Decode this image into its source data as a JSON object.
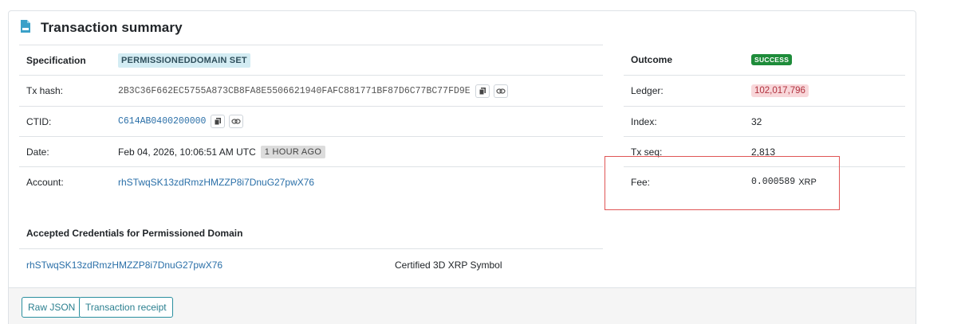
{
  "header": {
    "title": "Transaction summary",
    "icon": "document-icon"
  },
  "left": {
    "specification_label": "Specification",
    "tx_type": "PERMISSIONEDDOMAIN SET",
    "tx_hash_label": "Tx hash:",
    "tx_hash": "2B3C36F662EC5755A873CB8FA8E5506621940FAFC881771BF87D6C77BC77FD9E",
    "ctid_label": "CTID:",
    "ctid": "C614AB0400200000",
    "date_label": "Date:",
    "date": "Feb 04, 2026, 10:06:51 AM UTC",
    "date_ago": "1 HOUR AGO",
    "account_label": "Account:",
    "account": "rhSTwqSK13zdRmzHMZZP8i7DnuG27pwX76"
  },
  "right": {
    "outcome_label": "Outcome",
    "outcome": "SUCCESS",
    "ledger_label": "Ledger:",
    "ledger": "102,017,796",
    "index_label": "Index:",
    "index": "32",
    "txseq_label": "Tx seq:",
    "txseq": "2,813",
    "fee_label": "Fee:",
    "fee_amount": "0.000589",
    "fee_currency": "XRP"
  },
  "credentials": {
    "heading": "Accepted Credentials for Permissioned Domain",
    "rows": [
      {
        "issuer": "rhSTwqSK13zdRmzHMZZP8i7DnuG27pwX76",
        "type": "Certified 3D XRP Symbol"
      }
    ]
  },
  "footer": {
    "raw_json": "Raw JSON",
    "receipt": "Transaction receipt"
  },
  "colors": {
    "accent": "#2a8f9f",
    "link": "#2a6fa8",
    "success": "#1e8c3a",
    "highlight": "#e05555"
  }
}
